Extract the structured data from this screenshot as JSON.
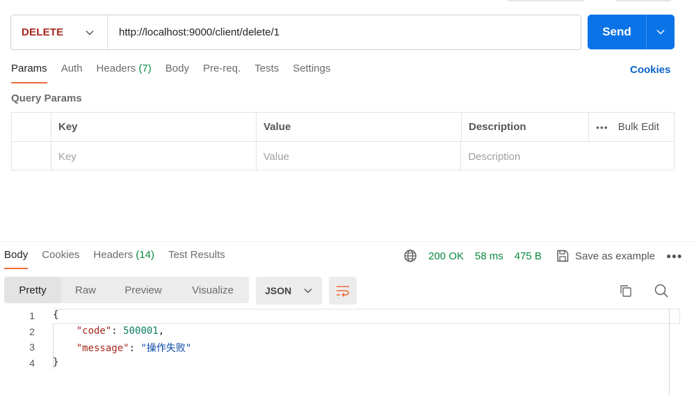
{
  "request": {
    "method": "DELETE",
    "url": "http://localhost:9000/client/delete/1",
    "send_label": "Send"
  },
  "request_tabs": [
    {
      "label": "Params",
      "count": ""
    },
    {
      "label": "Auth",
      "count": ""
    },
    {
      "label": "Headers",
      "count": "(7)"
    },
    {
      "label": "Body",
      "count": ""
    },
    {
      "label": "Pre-req.",
      "count": ""
    },
    {
      "label": "Tests",
      "count": ""
    },
    {
      "label": "Settings",
      "count": ""
    }
  ],
  "cookies_link": "Cookies",
  "query_params": {
    "title": "Query Params",
    "headers": [
      "Key",
      "Value",
      "Description"
    ],
    "bulk_edit": "Bulk Edit",
    "placeholders": {
      "key": "Key",
      "value": "Value",
      "description": "Description"
    }
  },
  "response_tabs": [
    {
      "label": "Body",
      "count": ""
    },
    {
      "label": "Cookies",
      "count": ""
    },
    {
      "label": "Headers",
      "count": "(14)"
    },
    {
      "label": "Test Results",
      "count": ""
    }
  ],
  "status": {
    "code": "200 OK",
    "time": "58 ms",
    "size": "475 B",
    "save_label": "Save as example"
  },
  "view_modes": [
    "Pretty",
    "Raw",
    "Preview",
    "Visualize"
  ],
  "format": "JSON",
  "code": {
    "line_numbers": [
      "1",
      "2",
      "3",
      "4"
    ],
    "open_brace": "{",
    "close_brace": "}",
    "code_key": "\"code\"",
    "code_value": "500001",
    "message_key": "\"message\"",
    "message_value": "\"操作失败\""
  },
  "colors": {
    "accent": "#f26b3a",
    "primary": "#0a73e7",
    "method": "#a7261c",
    "success": "#0a8a3e"
  }
}
